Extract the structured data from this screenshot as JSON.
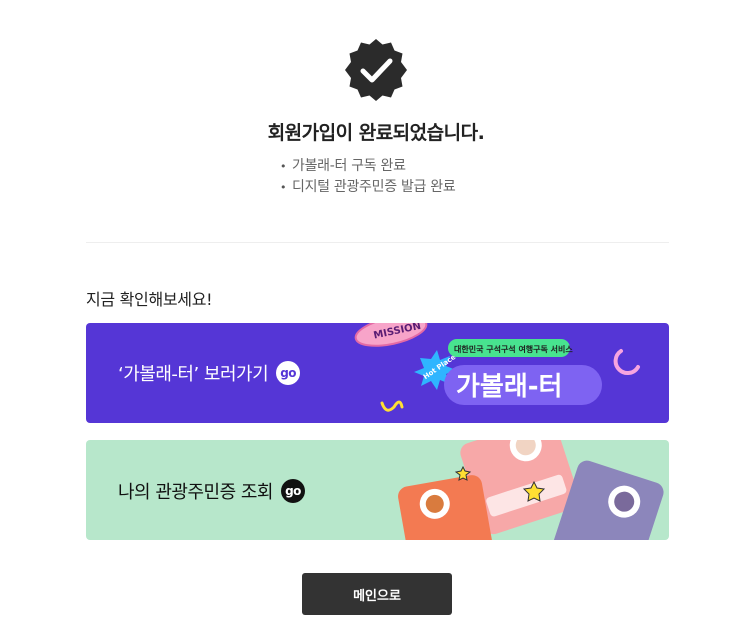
{
  "status": {
    "title": "회원가입이 완료되었습니다.",
    "items": [
      "가볼래-터 구독 완료",
      "디지털 관광주민증 발급 완료"
    ],
    "bullet": "•"
  },
  "section": {
    "title": "지금 확인해보세요!"
  },
  "banners": [
    {
      "label": "‘가볼래-터’ 보러가기",
      "go": "go",
      "bg_color": "#5536d6",
      "art": {
        "mission_text": "MISSION",
        "hot_place": "Hot Place",
        "tagline": "대한민국 구석구석 여행구독 서비스",
        "logo": "가볼래-터"
      }
    },
    {
      "label": "나의 관광주민증 조회",
      "go": "go",
      "bg_color": "#b7e7cb"
    }
  ],
  "footer": {
    "main_button": "메인으로"
  },
  "colors": {
    "badge": "#2b2b2b",
    "button": "#333333",
    "accent_purple": "#5536d6",
    "accent_mint": "#b7e7cb"
  }
}
